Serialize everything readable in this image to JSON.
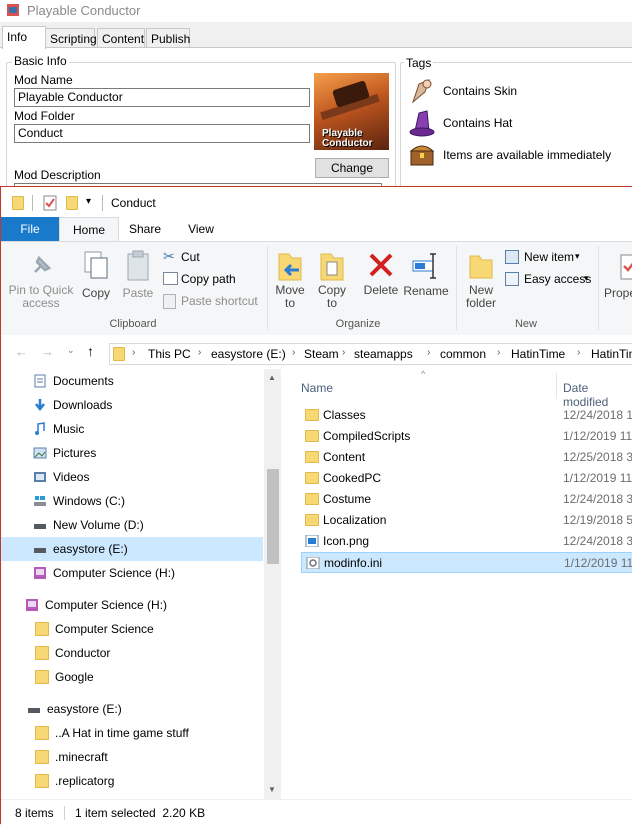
{
  "mod_window": {
    "title": "Playable Conductor",
    "tabs": [
      "Info",
      "Scripting",
      "Content",
      "Publish"
    ],
    "basic_info_label": "Basic Info",
    "mod_name_label": "Mod Name",
    "mod_name_value": "Playable Conductor",
    "mod_folder_label": "Mod Folder",
    "mod_folder_value": "Conduct",
    "mod_description_label": "Mod Description",
    "change_button": "Change",
    "thumbnail_text": "Playable Conductor",
    "tags_label": "Tags",
    "tags": [
      "Contains Skin",
      "Contains Hat",
      "Items are available immediately"
    ]
  },
  "explorer": {
    "title": "Conduct",
    "ribbon_tabs": [
      "File",
      "Home",
      "Share",
      "View"
    ],
    "clipboard": {
      "pin": "Pin to Quick access",
      "copy": "Copy",
      "paste": "Paste",
      "cut": "Cut",
      "copy_path": "Copy path",
      "paste_shortcut": "Paste shortcut",
      "group": "Clipboard"
    },
    "organize": {
      "move_to": "Move to",
      "copy_to": "Copy to",
      "delete": "Delete",
      "rename": "Rename",
      "group": "Organize"
    },
    "new": {
      "new_folder": "New folder",
      "new_item": "New item",
      "easy_access": "Easy access",
      "group": "New"
    },
    "open": {
      "properties": "Prope"
    },
    "breadcrumb": [
      "This PC",
      "easystore (E:)",
      "Steam",
      "steamapps",
      "common",
      "HatinTime",
      "HatinTim"
    ],
    "nav_items": [
      {
        "label": "Documents",
        "icon": "documents-icon"
      },
      {
        "label": "Downloads",
        "icon": "downloads-icon"
      },
      {
        "label": "Music",
        "icon": "music-icon"
      },
      {
        "label": "Pictures",
        "icon": "pictures-icon"
      },
      {
        "label": "Videos",
        "icon": "videos-icon"
      },
      {
        "label": "Windows (C:)",
        "icon": "drive-icon"
      },
      {
        "label": "New Volume (D:)",
        "icon": "drive-icon"
      },
      {
        "label": "easystore (E:)",
        "icon": "drive-icon"
      },
      {
        "label": "Computer Science (H:)",
        "icon": "network-drive-icon"
      },
      {
        "label": "Computer Science (H:)",
        "icon": "network-drive-icon"
      },
      {
        "label": "Computer Science",
        "icon": "folder-icon"
      },
      {
        "label": "Conductor",
        "icon": "folder-icon"
      },
      {
        "label": "Google",
        "icon": "folder-icon"
      },
      {
        "label": "easystore (E:)",
        "icon": "drive-icon"
      },
      {
        "label": "..A Hat in time game stuff",
        "icon": "folder-icon"
      },
      {
        "label": ".minecraft",
        "icon": "folder-icon"
      },
      {
        "label": ".replicatorg",
        "icon": "folder-icon"
      }
    ],
    "columns": {
      "name": "Name",
      "date": "Date modified"
    },
    "files": [
      {
        "name": "Classes",
        "date": "12/24/2018 11",
        "icon": "folder-icon"
      },
      {
        "name": "CompiledScripts",
        "date": "1/12/2019 11:",
        "icon": "folder-icon"
      },
      {
        "name": "Content",
        "date": "12/25/2018 3:",
        "icon": "folder-icon"
      },
      {
        "name": "CookedPC",
        "date": "1/12/2019 11:",
        "icon": "folder-icon"
      },
      {
        "name": "Costume",
        "date": "12/24/2018 3:",
        "icon": "folder-icon"
      },
      {
        "name": "Localization",
        "date": "12/19/2018 5:",
        "icon": "folder-icon"
      },
      {
        "name": "Icon.png",
        "date": "12/24/2018 3:",
        "icon": "image-file-icon"
      },
      {
        "name": "modinfo.ini",
        "date": "1/12/2019 11:",
        "icon": "settings-file-icon"
      }
    ],
    "status": {
      "count": "8 items",
      "selection": "1 item selected  2.20 KB"
    }
  }
}
